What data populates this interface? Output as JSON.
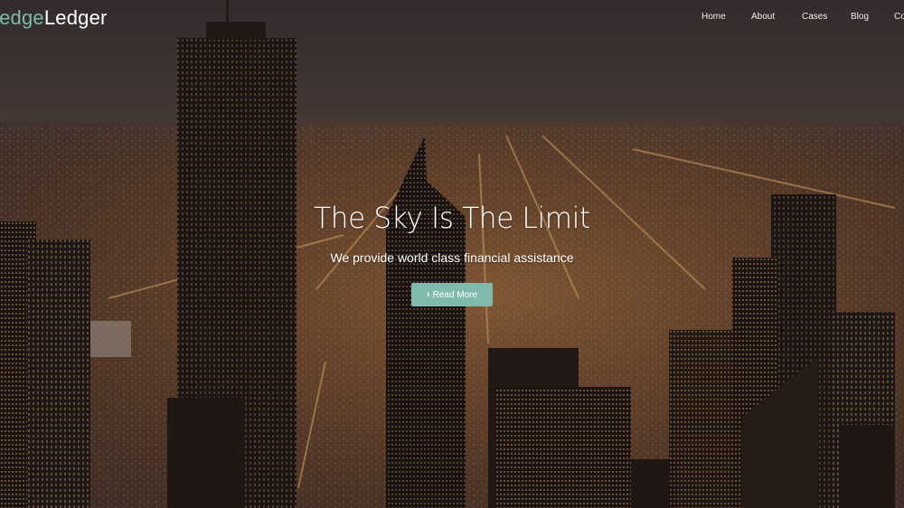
{
  "brand": {
    "logo_first": "Hedge",
    "logo_second": "Ledger"
  },
  "nav": {
    "items": [
      {
        "label": "Home"
      },
      {
        "label": "About"
      },
      {
        "label": "Cases"
      },
      {
        "label": "Blog"
      },
      {
        "label": "Contact"
      }
    ]
  },
  "hero": {
    "headline": "The Sky Is The Limit",
    "subheadline": "We provide world class financial assistance",
    "cta_label": "Read More",
    "cta_icon": "chevron-right-icon",
    "cta_color": "#7fbaac",
    "background_image": "night-city-skyline"
  }
}
